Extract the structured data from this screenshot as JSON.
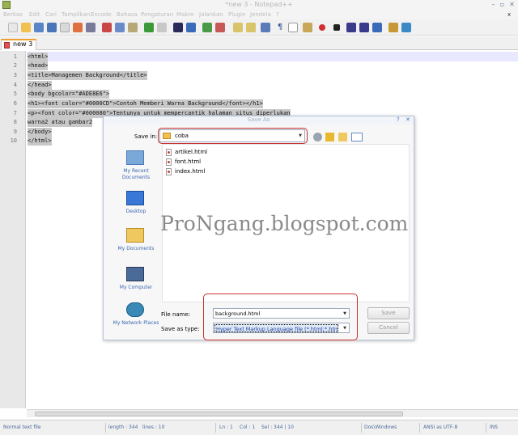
{
  "window": {
    "title": "*new 3 - Notepad++"
  },
  "menu": [
    "Berkas",
    "Edit",
    "Cari",
    "Tampilkan",
    "Encode",
    "Bahasa",
    "Pengaturan",
    "Makro",
    "Jalankan",
    "Plugin",
    "Jendela",
    "?"
  ],
  "tab": {
    "label": "new 3"
  },
  "editor": {
    "line_numbers": [
      "1",
      "2",
      "3",
      "4",
      "5",
      "6",
      "7",
      "8",
      "9",
      "10"
    ],
    "lines": [
      "<html>",
      "<head>",
      "<title>Managemen Background</title>",
      "</head>",
      "<body bgcolor=\"#ADE8E6\">",
      "<h1><font color=\"#0000CD\">Contoh Memberi Warna Background</font></h1>",
      "<p><font color=\"#000080\">Tentunya untuk mempercantik halaman situs diperlukan",
      "warna2 atau gambar2",
      "</body>",
      "</html>"
    ]
  },
  "status": {
    "file_type": "Normal text file",
    "length": "length : 344",
    "lines": "lines : 10",
    "ln": "Ln : 1",
    "col": "Col : 1",
    "sel": "Sel : 344 | 10",
    "eol": "Dos\\Windows",
    "encoding": "ANSI as UTF-8",
    "mode": "INS"
  },
  "dialog": {
    "title": "Save As",
    "save_in_label": "Save in:",
    "save_in_value": "coba",
    "places": [
      "My Recent Documents",
      "Desktop",
      "My Documents",
      "My Computer",
      "My Network Places"
    ],
    "files": [
      "artikel.html",
      "font.html",
      "index.html"
    ],
    "file_name_label": "File name:",
    "file_name_value": "background.html",
    "save_as_type_label": "Save as type:",
    "save_as_type_value": "Hyper Text Markup Language file (*.html;*.htm;*",
    "save_button": "Save",
    "cancel_button": "Cancel"
  },
  "watermark": "ProNgang.blogspot.com"
}
